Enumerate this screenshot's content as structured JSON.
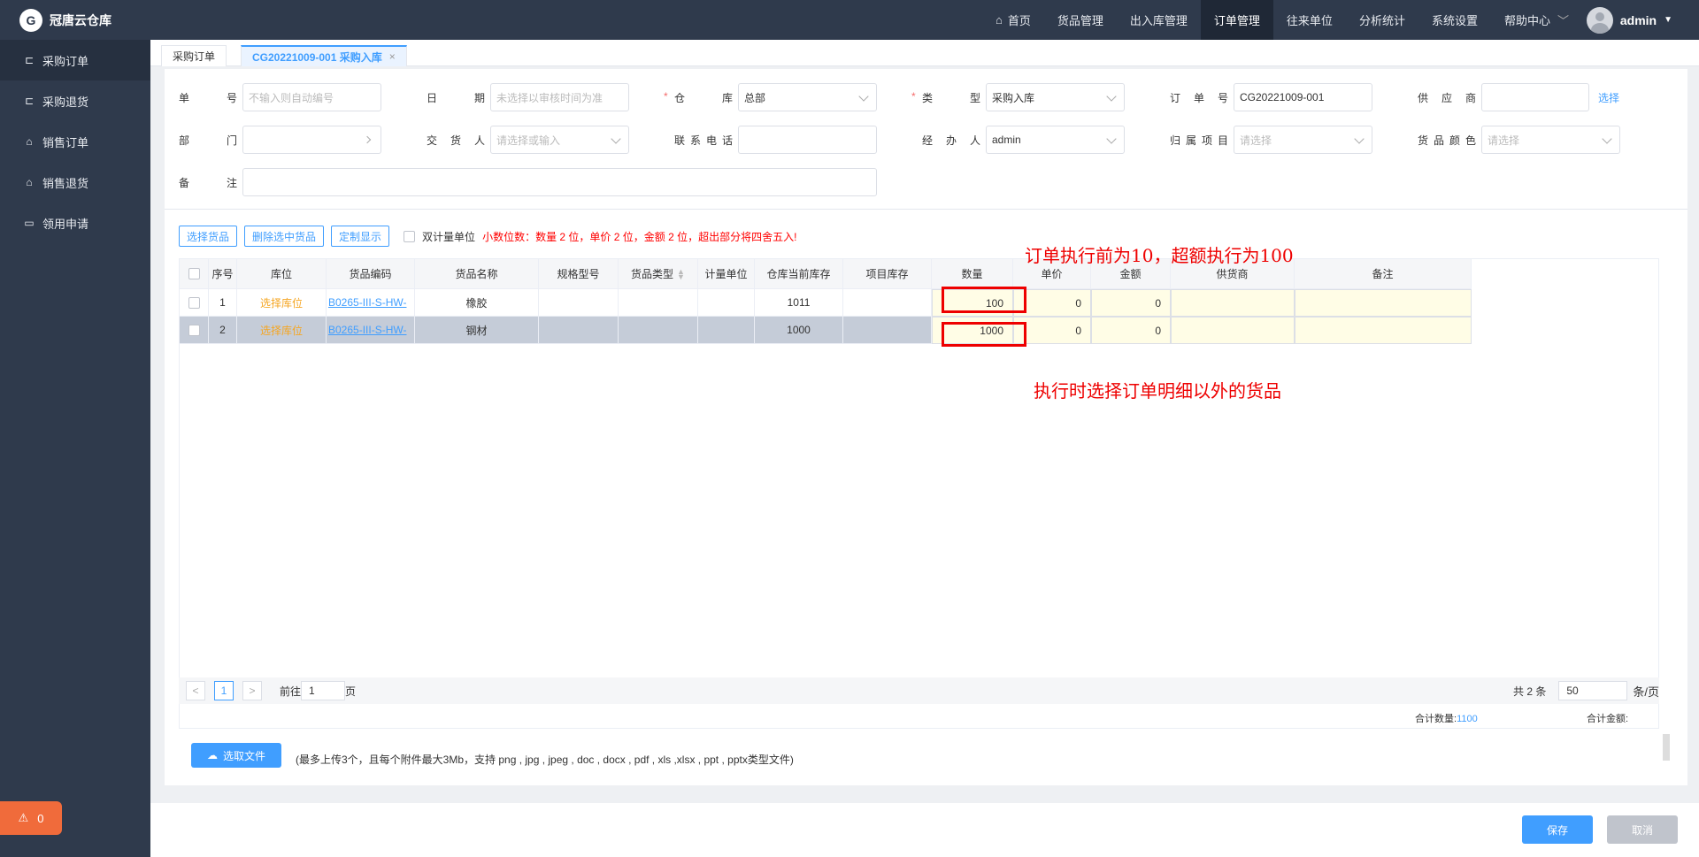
{
  "app": {
    "title": "冠唐云仓库",
    "logo_mark": "G"
  },
  "sidebar": {
    "items": [
      {
        "label": "采购订单",
        "icon": "cart-icon"
      },
      {
        "label": "采购退货",
        "icon": "cart-icon"
      },
      {
        "label": "销售订单",
        "icon": "bag-icon"
      },
      {
        "label": "销售退货",
        "icon": "bag-icon"
      },
      {
        "label": "领用申请",
        "icon": "folder-icon"
      }
    ],
    "alarm_count": "0"
  },
  "topnav": {
    "items": [
      "首页",
      "货品管理",
      "出入库管理",
      "订单管理",
      "往来单位",
      "分析统计",
      "系统设置",
      "帮助中心"
    ],
    "active": "订单管理",
    "user": "admin"
  },
  "tabs": [
    {
      "label": "采购订单"
    },
    {
      "label": "CG20221009-001 采购入库",
      "close": "×"
    }
  ],
  "form": {
    "order_no": {
      "label": [
        "单",
        "号"
      ],
      "placeholder": "不输入则自动编号"
    },
    "date": {
      "label": [
        "日",
        "期"
      ],
      "placeholder": "未选择以审核时间为准"
    },
    "warehouse": {
      "label": [
        "仓",
        "库"
      ],
      "value": "总部",
      "required": "*"
    },
    "type": {
      "label": [
        "类",
        "型"
      ],
      "value": "采购入库",
      "required": "*"
    },
    "ref_no": {
      "label": [
        "订",
        "单",
        "号"
      ],
      "value": "CG20221009-001"
    },
    "supplier": {
      "label": [
        "供",
        "应",
        "商"
      ],
      "value": "",
      "link": "选择"
    },
    "dept": {
      "label": [
        "部",
        "门"
      ],
      "value": ""
    },
    "deliverer": {
      "label": [
        "交",
        "货",
        "人"
      ],
      "placeholder": "请选择或输入"
    },
    "phone": {
      "label": [
        "联",
        "系",
        "电",
        "话"
      ],
      "value": ""
    },
    "handler": {
      "label": [
        "经",
        "办",
        "人"
      ],
      "value": "admin"
    },
    "project": {
      "label": [
        "归",
        "属",
        "项",
        "目"
      ],
      "placeholder": "请选择"
    },
    "color": {
      "label": [
        "货",
        "品",
        "颜",
        "色"
      ],
      "placeholder": "请选择"
    },
    "remark": {
      "label": [
        "备",
        "注"
      ],
      "value": ""
    }
  },
  "toolbar": {
    "select_goods": "选择货品",
    "delete_selected": "删除选中货品",
    "custom_display": "定制显示",
    "dual_unit": "双计量单位",
    "decimal_note": "小数位数：数量 2 位，单价 2 位，金额 2 位，超出部分将四舍五入!"
  },
  "table": {
    "headers": [
      "序号",
      "库位",
      "货品编码",
      "货品名称",
      "规格型号",
      "货品类型",
      "计量单位",
      "仓库当前库存",
      "项目库存",
      "数量",
      "单价",
      "金额",
      "供货商",
      "备注"
    ],
    "rows": [
      {
        "seq": "1",
        "location": "选择库位",
        "code": "B0265-III-S-HW-",
        "name": "橡胶",
        "spec": "",
        "gtype": "",
        "unit": "",
        "stock": "1011",
        "proj_stock": "",
        "qty": "100",
        "price": "0",
        "amount": "0",
        "supplier": "",
        "remark": ""
      },
      {
        "seq": "2",
        "location": "选择库位",
        "code": "B0265-III-S-HW-",
        "name": "钢材",
        "spec": "",
        "gtype": "",
        "unit": "",
        "stock": "1000",
        "proj_stock": "",
        "qty": "1000",
        "price": "0",
        "amount": "0",
        "supplier": "",
        "remark": ""
      }
    ]
  },
  "annotations": {
    "top": "订单执行前为10，超额执行为100",
    "bottom": "执行时选择订单明细以外的货品"
  },
  "pager": {
    "prev": "<",
    "page": "1",
    "next": ">",
    "goto_prefix": "前往",
    "goto_value": "1",
    "goto_suffix": "页",
    "total": "共 2 条",
    "page_size": "50",
    "page_size_suffix": "条/页"
  },
  "totals": {
    "qty_label": "合计数量:",
    "qty_value": "1100",
    "amount_label": "合计金额:"
  },
  "upload": {
    "button": "选取文件",
    "note": "(最多上传3个，且每个附件最大3Mb，支持 png , jpg , jpeg , doc , docx , pdf , xls ,xlsx , ppt , pptx类型文件)"
  },
  "footer": {
    "save": "保存",
    "cancel": "取消"
  }
}
